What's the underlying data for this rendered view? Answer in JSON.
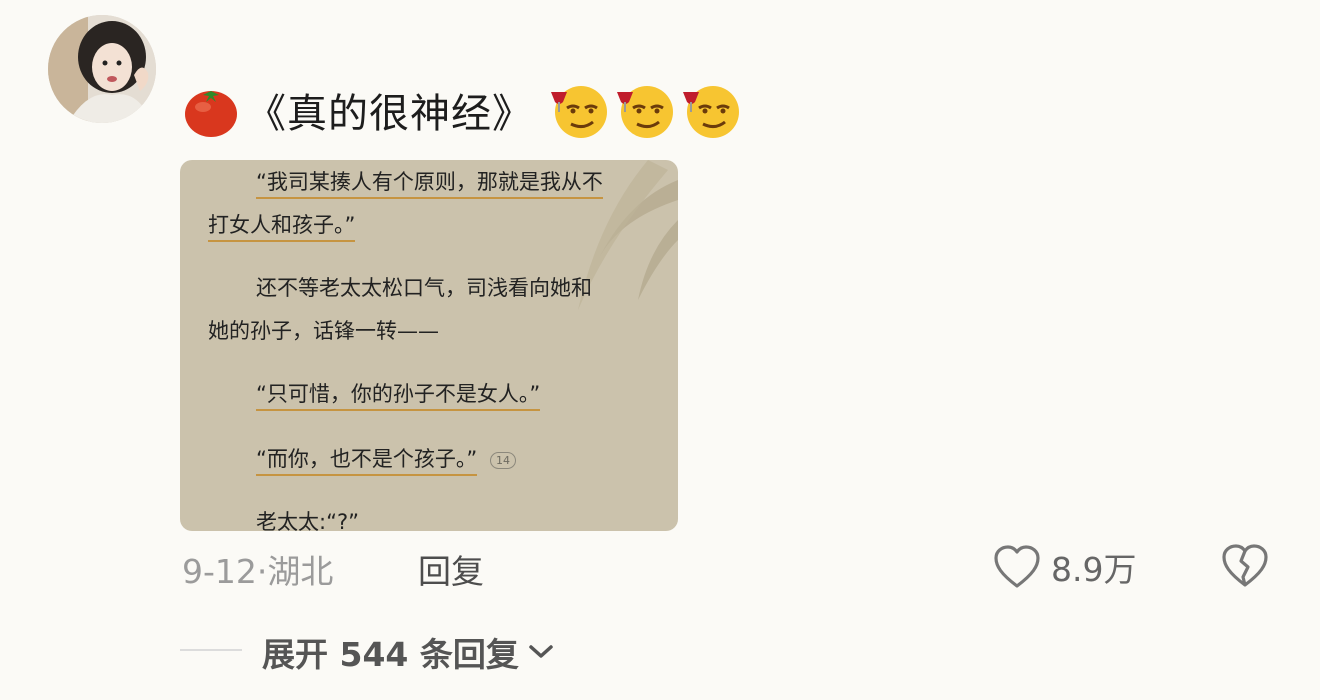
{
  "comment": {
    "title": "《真的很神经》",
    "meta_date": "9-12",
    "meta_sep": "·",
    "meta_location": "湖北",
    "reply_label": "回复",
    "like_count": "8.9万",
    "expand_label": "展开 544 条回复"
  },
  "excerpt": {
    "lines": [
      "“我司某揍人有个原则，那就是我从不",
      "打女人和孩子。”",
      "还不等老太太松口气，司浅看向她和",
      "她的孙子，话锋一转——",
      "“只可惜，你的孙子不是女人。”",
      "“而你，也不是个孩子。”",
      "老太太:“?”"
    ],
    "note_badge": "14"
  },
  "icons": {
    "leading": "tomato-icon",
    "emojis": [
      "smirk-wine-emoji",
      "smirk-wine-emoji",
      "smirk-wine-emoji"
    ],
    "like": "heart-outline-icon",
    "dislike": "broken-heart-icon",
    "expand": "chevron-down-icon"
  },
  "colors": {
    "background": "#fbfaf6",
    "excerpt_background": "#cbc2ac",
    "underline": "#c69441",
    "muted_text": "#9b9b9b"
  }
}
